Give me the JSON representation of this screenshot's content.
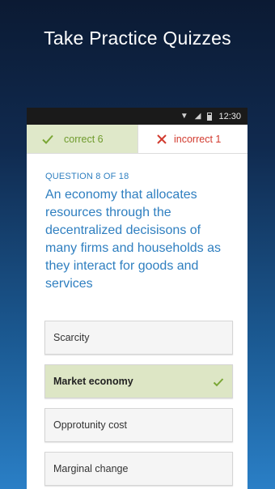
{
  "promo": {
    "title": "Take Practice Quizzes"
  },
  "status_bar": {
    "time": "12:30"
  },
  "score": {
    "correct_label": "correct 6",
    "incorrect_label": "incorrect 1",
    "correct_color": "#6f9b2d",
    "incorrect_color": "#d23a2e"
  },
  "question": {
    "number_label": "QUESTION 8 OF 18",
    "text": "An economy that allocates resources through the decentralized decisisons of many firms and households as they interact for goods and services"
  },
  "options": [
    {
      "label": "Scarcity",
      "selected": false
    },
    {
      "label": "Market economy",
      "selected": true
    },
    {
      "label": "Opprotunity cost",
      "selected": false
    },
    {
      "label": "Marginal change",
      "selected": false
    }
  ]
}
